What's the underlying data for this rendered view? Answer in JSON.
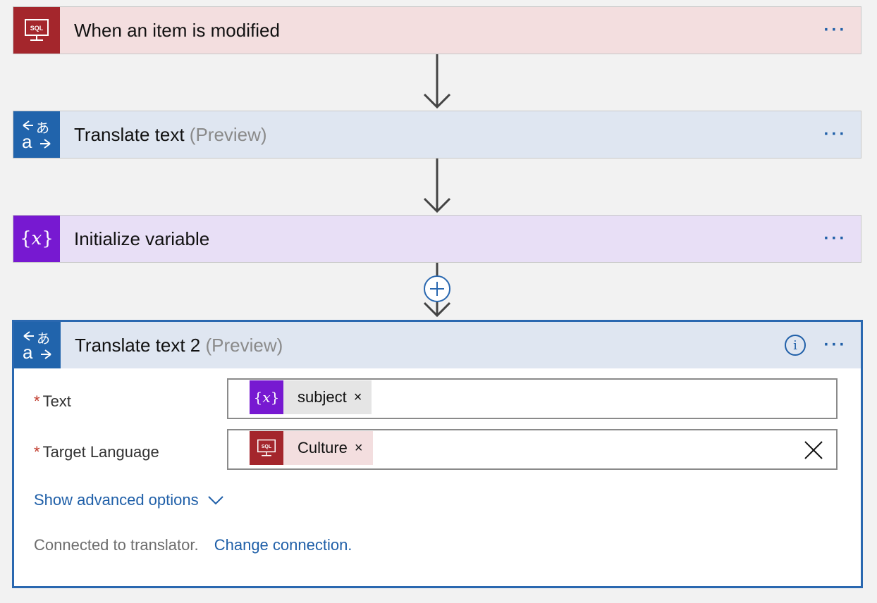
{
  "steps": [
    {
      "title": "When an item is modified",
      "icon": "sql-icon",
      "color": "#a4262c",
      "bg": "#f3dedf"
    },
    {
      "title": "Translate text",
      "suffix": "(Preview)",
      "icon": "translator-icon",
      "color": "#2164ac",
      "bg": "#dfe6f1"
    },
    {
      "title": "Initialize variable",
      "icon": "variable-icon",
      "color": "#7719d1",
      "bg": "#e8dff6"
    }
  ],
  "icon_text": {
    "sql": "SQL",
    "var_open": "{",
    "var_x": "x",
    "var_close": "}",
    "tr_a": "a",
    "tr_jp": "あ"
  },
  "more_label": "···",
  "action": {
    "title": "Translate text 2",
    "suffix": "(Preview)",
    "info_label": "i",
    "fields": [
      {
        "label": "Text",
        "required": "*",
        "token": "subject",
        "token_type": "variable",
        "token_bg": "#e5e5e5",
        "remove": "×"
      },
      {
        "label": "Target Language",
        "required": "*",
        "token": "Culture",
        "token_type": "sql",
        "token_bg": "#f3dedf",
        "remove": "×"
      }
    ],
    "advanced_link": "Show advanced options",
    "connection_text": "Connected to translator.",
    "change_link": "Change connection."
  },
  "colors": {
    "accent": "#2a68b0",
    "sql": "#a4262c",
    "translator": "#2164ac",
    "variable": "#7719d1"
  }
}
